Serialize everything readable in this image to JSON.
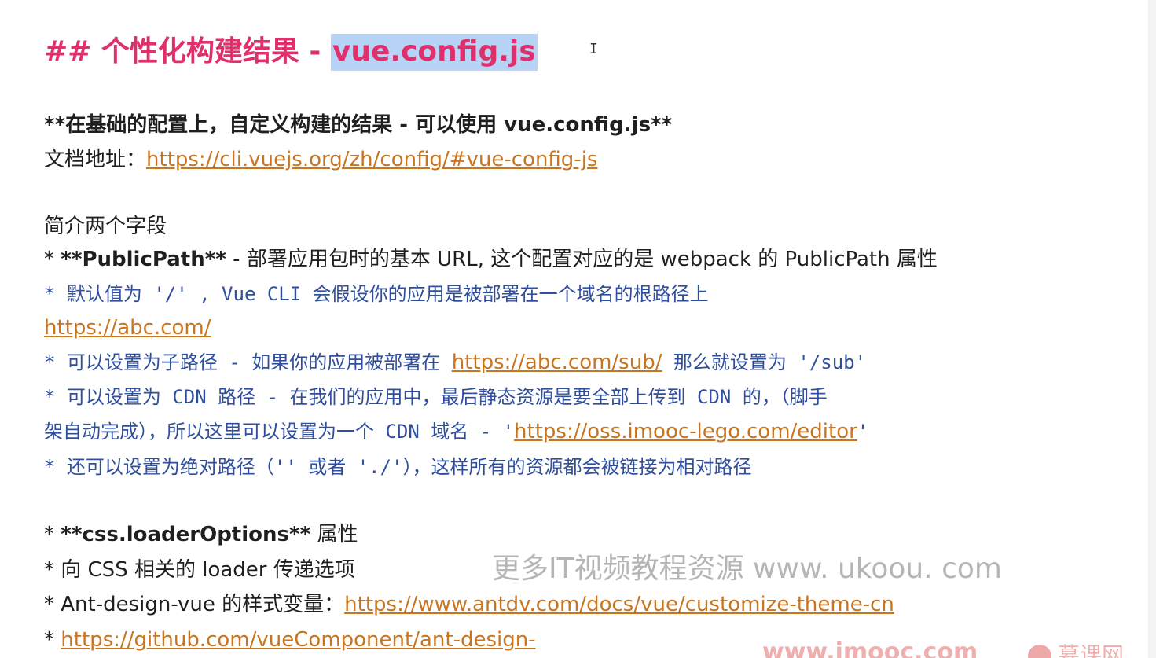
{
  "heading": {
    "prefix": "## 个性化构建结果 - ",
    "highlight": "vue.config.js"
  },
  "intro": {
    "bold_line": "**在基础的配置上，自定义构建的结果 - 可以使用 vue.config.js**",
    "doc_label": "文档地址：",
    "doc_link": "https://cli.vuejs.org/zh/config/#vue-config-js"
  },
  "section1": {
    "title": "简介两个字段",
    "publicpath_bullet": "* ",
    "publicpath_name": "**PublicPath**",
    "publicpath_desc": " - 部署应用包时的基本 URL, 这个配置对应的是 webpack 的 PublicPath 属性",
    "sub1": "  * 默认值为 '/' , Vue CLI 会假设你的应用是被部署在一个域名的根路径上",
    "sub1_link": "https://abc.com/",
    "sub2_pre": "  * 可以设置为子路径 - 如果你的应用被部署在 ",
    "sub2_link": "https://abc.com/sub/",
    "sub2_post": " 那么就设置为 '/sub'",
    "sub3_line1": "  * 可以设置为 CDN 路径 - 在我们的应用中，最后静态资源是要全部上传到 CDN 的，（脚手",
    "sub3_line2_pre": "架自动完成），所以这里可以设置为一个 CDN 域名 - '",
    "sub3_link": "https://oss.imooc-lego.com/editor",
    "sub3_line2_post": "'",
    "sub4": "  * 还可以设置为绝对路径（'' 或者 './'），这样所有的资源都会被链接为相对路径"
  },
  "section2": {
    "b1_star": "*  ",
    "b1_name": "**css.loaderOptions**",
    "b1_post": " 属性",
    "b2": "*  向 CSS 相关的 loader 传递选项",
    "b3_pre": "*  Ant-design-vue 的样式变量：",
    "b3_link": "https://www.antdv.com/docs/vue/customize-theme-cn",
    "b4_star": "*  ",
    "b4_link": "https://github.com/vueComponent/ant-design-"
  },
  "watermark": {
    "text": "更多IT视频教程资源 www. ukoou. com",
    "site": "www.imooc.com",
    "brand": "慕课网"
  }
}
